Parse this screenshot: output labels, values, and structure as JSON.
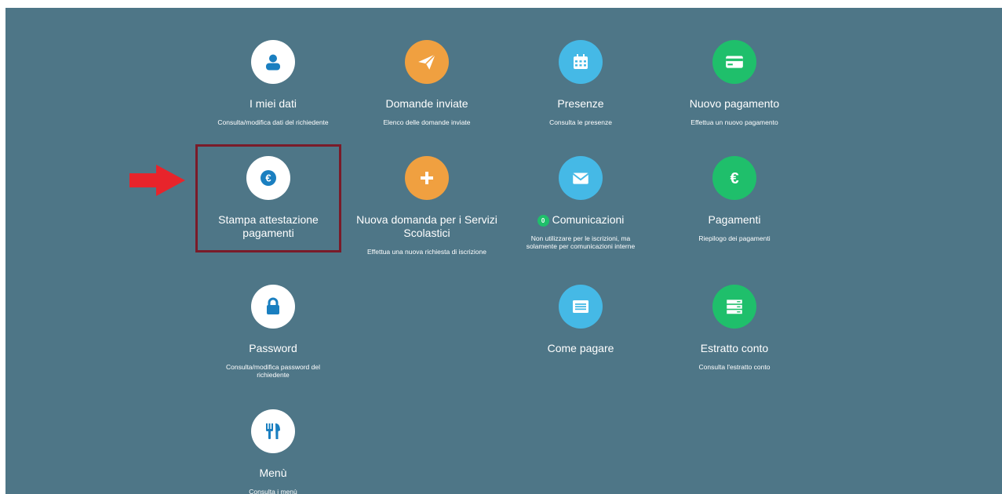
{
  "colors": {
    "panel_bg": "#4e7687",
    "white_circle": "#ffffff",
    "orange": "#f0a040",
    "light_blue": "#45b9e6",
    "green": "#1fbf6b",
    "blue_icon": "#1a7fc0",
    "highlight_border": "#7a1b29",
    "arrow_red": "#e8242b"
  },
  "tiles": [
    {
      "title": "I miei dati",
      "desc": "Consulta/modifica dati del richiedente",
      "icon": "user-icon"
    },
    {
      "title": "Domande inviate",
      "desc": "Elenco delle domande inviate",
      "icon": "paper-plane-icon"
    },
    {
      "title": "Presenze",
      "desc": "Consulta le presenze",
      "icon": "calendar-icon"
    },
    {
      "title": "Nuovo pagamento",
      "desc": "Effettua un nuovo pagamento",
      "icon": "credit-card-icon"
    },
    {
      "title": "Stampa attestazione pagamenti",
      "desc": "",
      "icon": "euro-icon"
    },
    {
      "title": "Nuova domanda per i Servizi Scolastici",
      "desc": "Effettua una nuova richiesta di iscrizione",
      "icon": "plus-icon"
    },
    {
      "title": "Comunicazioni",
      "badge": "0",
      "desc": "Non utilizzare per le iscrizioni, ma solamente per comunicazioni interne",
      "icon": "envelope-icon"
    },
    {
      "title": "Pagamenti",
      "desc": "Riepilogo dei pagamenti",
      "icon": "euro-icon"
    },
    {
      "title": "Password",
      "desc": "Consulta/modifica password del richiedente",
      "icon": "lock-icon"
    },
    {
      "title": "Come pagare",
      "desc": "",
      "icon": "list-icon"
    },
    {
      "title": "Estratto conto",
      "desc": "Consulta l'estratto conto",
      "icon": "server-icon"
    },
    {
      "title": "Menù",
      "desc": "Consulta i menù",
      "icon": "cutlery-icon"
    }
  ]
}
